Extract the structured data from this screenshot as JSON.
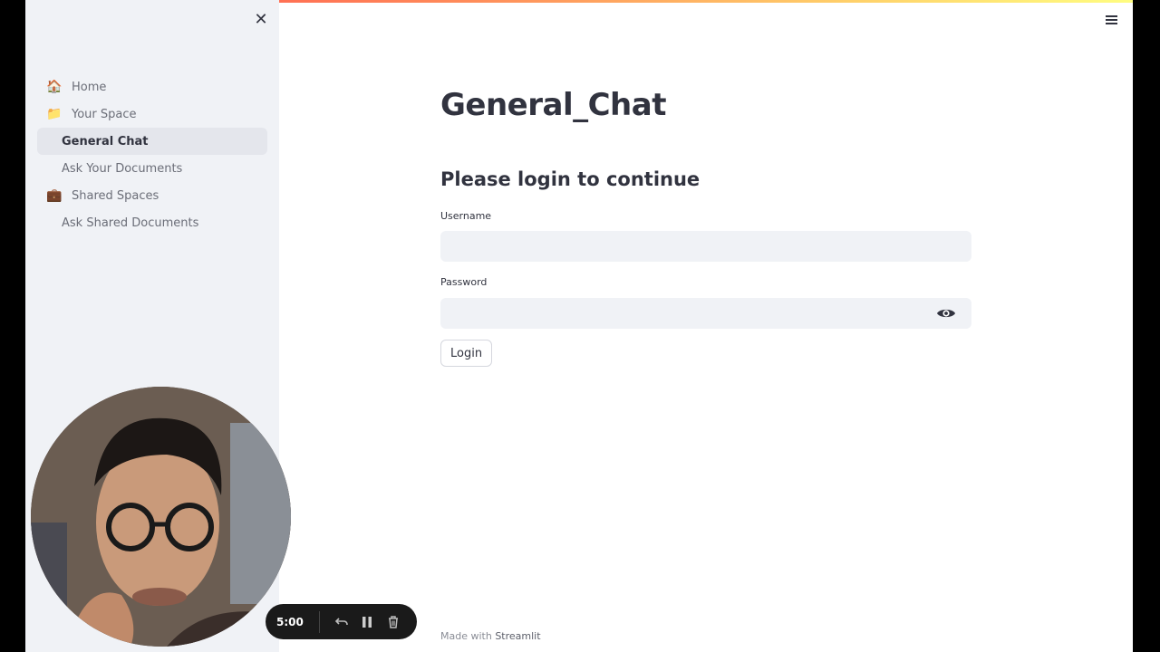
{
  "sidebar": {
    "close_icon": "close-icon",
    "items": [
      {
        "label": "Home",
        "emoji": "🏠",
        "active": false
      },
      {
        "label": "Your Space",
        "emoji": "📁",
        "active": false
      },
      {
        "label": "General Chat",
        "emoji": "",
        "active": true
      },
      {
        "label": "Ask Your Documents",
        "emoji": "",
        "active": false
      },
      {
        "label": "Shared Spaces",
        "emoji": "💼",
        "active": false
      },
      {
        "label": "Ask Shared Documents",
        "emoji": "",
        "active": false
      }
    ]
  },
  "main": {
    "title": "General_Chat",
    "login_heading": "Please login to continue",
    "username": {
      "label": "Username",
      "value": ""
    },
    "password": {
      "label": "Password",
      "value": ""
    },
    "login_button": "Login"
  },
  "footer": {
    "prefix": "Made with ",
    "brand": "Streamlit"
  },
  "recorder": {
    "time": "5:00"
  },
  "colors": {
    "accent": "#ff4b4b",
    "sidebar_bg": "#f0f2f6",
    "text": "#31333f"
  }
}
